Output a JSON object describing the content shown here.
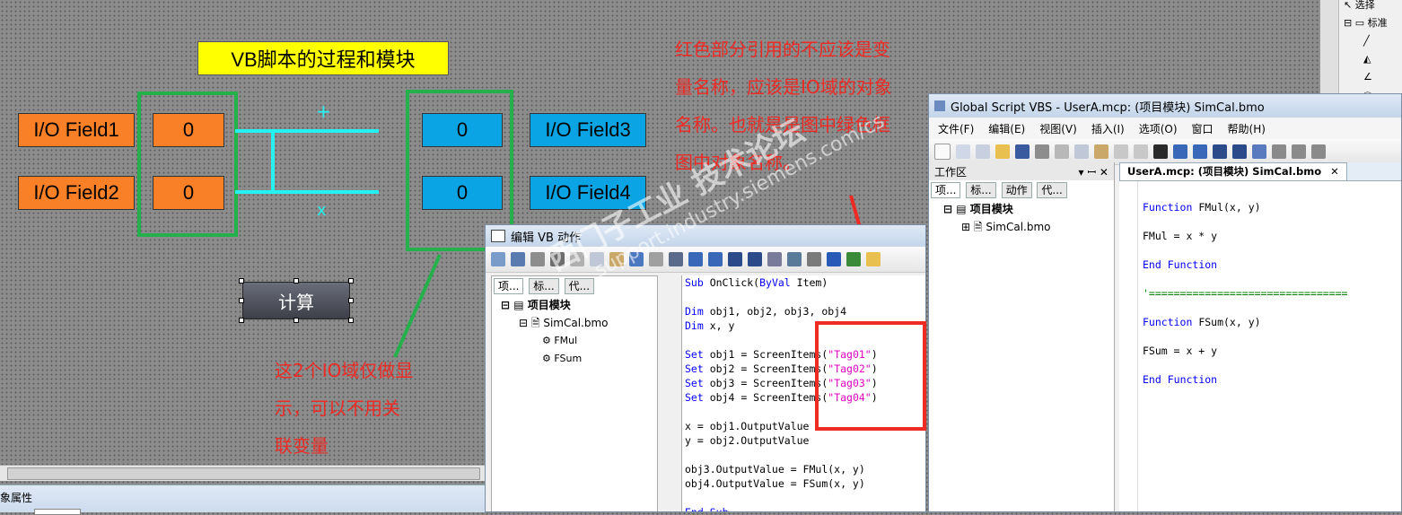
{
  "canvas": {
    "title": "VB脚本的过程和模块",
    "fields": {
      "io1": "I/O Field1",
      "io2": "I/O Field2",
      "io3": "I/O Field3",
      "io4": "I/O Field4",
      "val1": "0",
      "val2": "0",
      "val3": "0",
      "val4": "0"
    },
    "plus": "+",
    "times": "x",
    "calc_button": "计算",
    "note_top": [
      "红色部分引用的不应该是变",
      "量名称，应该是IO域的对象",
      "名称。也就是是图中绿色框",
      "图中对象名称。"
    ],
    "note_bottom": [
      "这2个IO域仅做显",
      "示，可以不用关",
      "联变量"
    ],
    "watermark_big": "西门子工业  技术论坛",
    "watermark_small": "support.industry.siemens.com/cs"
  },
  "bottom": {
    "properties_label": "象属性"
  },
  "vb_editor": {
    "title": "编辑 VB 动作",
    "tabs": [
      "项...",
      "标...",
      "代..."
    ],
    "tree": {
      "root": "项目模块",
      "file": "SimCal.bmo",
      "items": [
        "FMul",
        "FSum"
      ]
    },
    "code_lines": [
      "Sub OnClick(ByVal Item)",
      "",
      "Dim obj1, obj2, obj3, obj4",
      "Dim x, y",
      "",
      "Set obj1 = ScreenItems(\"Tag01\")",
      "Set obj2 = ScreenItems(\"Tag02\")",
      "Set obj3 = ScreenItems(\"Tag03\")",
      "Set obj4 = ScreenItems(\"Tag04\")",
      "",
      "x = obj1.OutputValue",
      "y = obj2.OutputValue",
      "",
      "obj3.OutputValue = FMul(x, y)",
      "obj4.OutputValue = FSum(x, y)",
      "",
      "End Sub"
    ]
  },
  "gsvbs": {
    "title": "Global Script VBS - UserA.mcp: (项目模块) SimCal.bmo",
    "menu": [
      "文件(F)",
      "编辑(E)",
      "视图(V)",
      "插入(I)",
      "选项(O)",
      "窗口",
      "帮助(H)"
    ],
    "workspace_label": "工作区",
    "workspace_controls": "▾ ꟷ ✕",
    "tabs": [
      "项...",
      "标...",
      "动作",
      "代..."
    ],
    "tree": {
      "root": "项目模块",
      "file": "SimCal.bmo"
    },
    "doc_tab": "UserA.mcp: (项目模块) SimCal.bmo",
    "code_lines": [
      "Function FMul(x, y)",
      "",
      "FMul = x * y",
      "",
      "End Function",
      "",
      "'================================",
      "",
      "Function FSum(x, y)",
      "",
      "FSum = x + y",
      "",
      "End Function"
    ]
  },
  "right_panel": {
    "items": [
      "选择",
      "标准"
    ]
  }
}
